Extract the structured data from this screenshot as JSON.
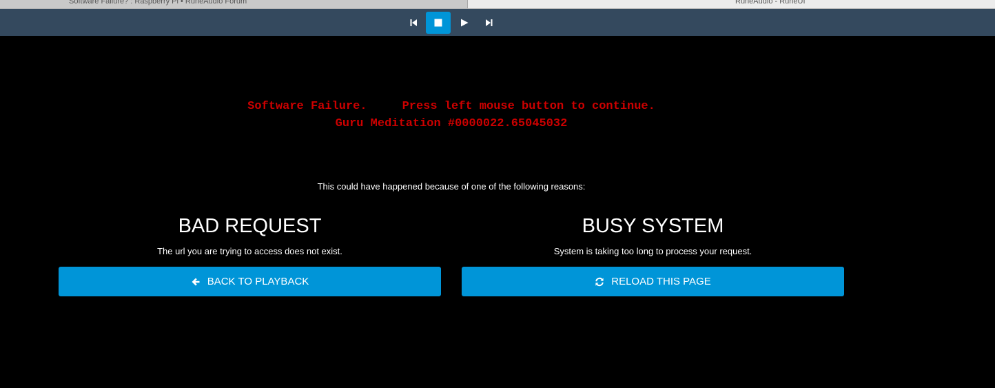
{
  "browser": {
    "tabs": [
      {
        "title": "Software Failure? : Raspberry Pi • RuneAudio Forum"
      },
      {
        "title": "RuneAudio - RuneUI"
      }
    ]
  },
  "player": {
    "buttons": [
      {
        "name": "previous",
        "icon": "skip-back-icon",
        "active": false
      },
      {
        "name": "stop",
        "icon": "stop-icon",
        "active": true
      },
      {
        "name": "play",
        "icon": "play-icon",
        "active": false
      },
      {
        "name": "next",
        "icon": "skip-forward-icon",
        "active": false
      }
    ],
    "active_color": "#0095d8",
    "bar_color": "#34495e"
  },
  "error": {
    "line1": "Software Failure.     Press left mouse button to continue.",
    "line2": "Guru Meditation #0000022.65045032",
    "color": "#cc0000"
  },
  "reasons": {
    "intro": "This could have happened because of one of the following reasons:",
    "left": {
      "title": "BAD REQUEST",
      "description": "The url you are trying to access does not exist.",
      "button_label": "BACK TO PLAYBACK",
      "button_icon": "arrow-left-icon"
    },
    "right": {
      "title": "BUSY SYSTEM",
      "description": "System is taking too long to process your request.",
      "button_label": "RELOAD THIS PAGE",
      "button_icon": "refresh-icon"
    }
  },
  "colors": {
    "button_blue": "#0095d8",
    "background": "#000000"
  }
}
